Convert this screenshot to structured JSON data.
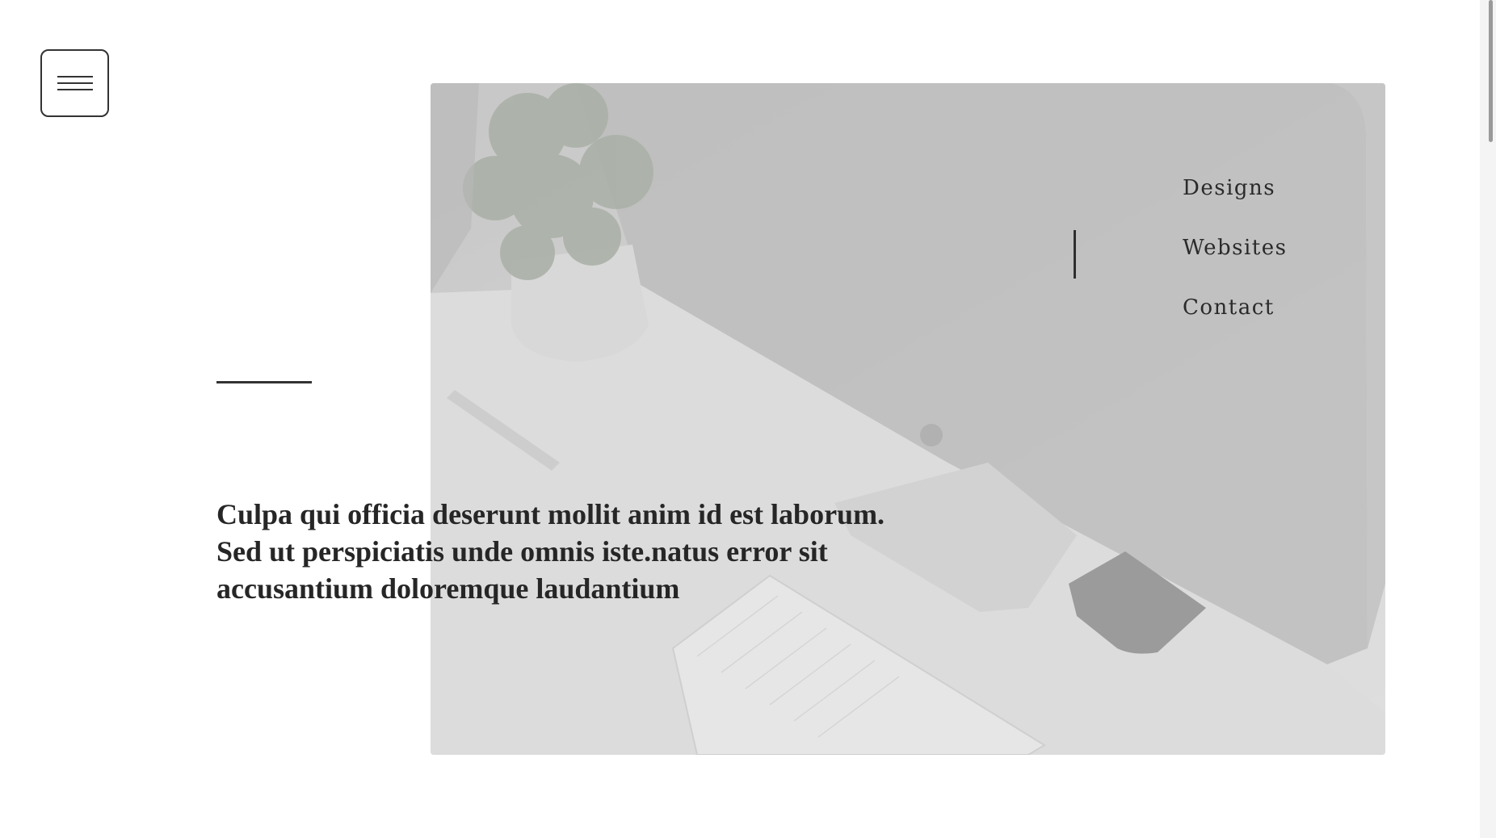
{
  "header": {
    "menu_icon": "hamburger-menu-icon"
  },
  "hero": {
    "image_subject": "desk-computer-keyboard-plant"
  },
  "nav": {
    "items": [
      {
        "label": "Designs"
      },
      {
        "label": "Websites"
      },
      {
        "label": "Contact"
      }
    ],
    "active_index": 1
  },
  "content": {
    "headline_lines": [
      "Culpa qui officia deserunt mollit anim id est laborum.",
      "Sed ut perspiciatis unde omnis iste.natus error sit",
      "accusantium doloremque laudantium"
    ]
  },
  "colors": {
    "text": "#262626",
    "hero_tint": "#cfcfcf",
    "accent": "#333333"
  }
}
